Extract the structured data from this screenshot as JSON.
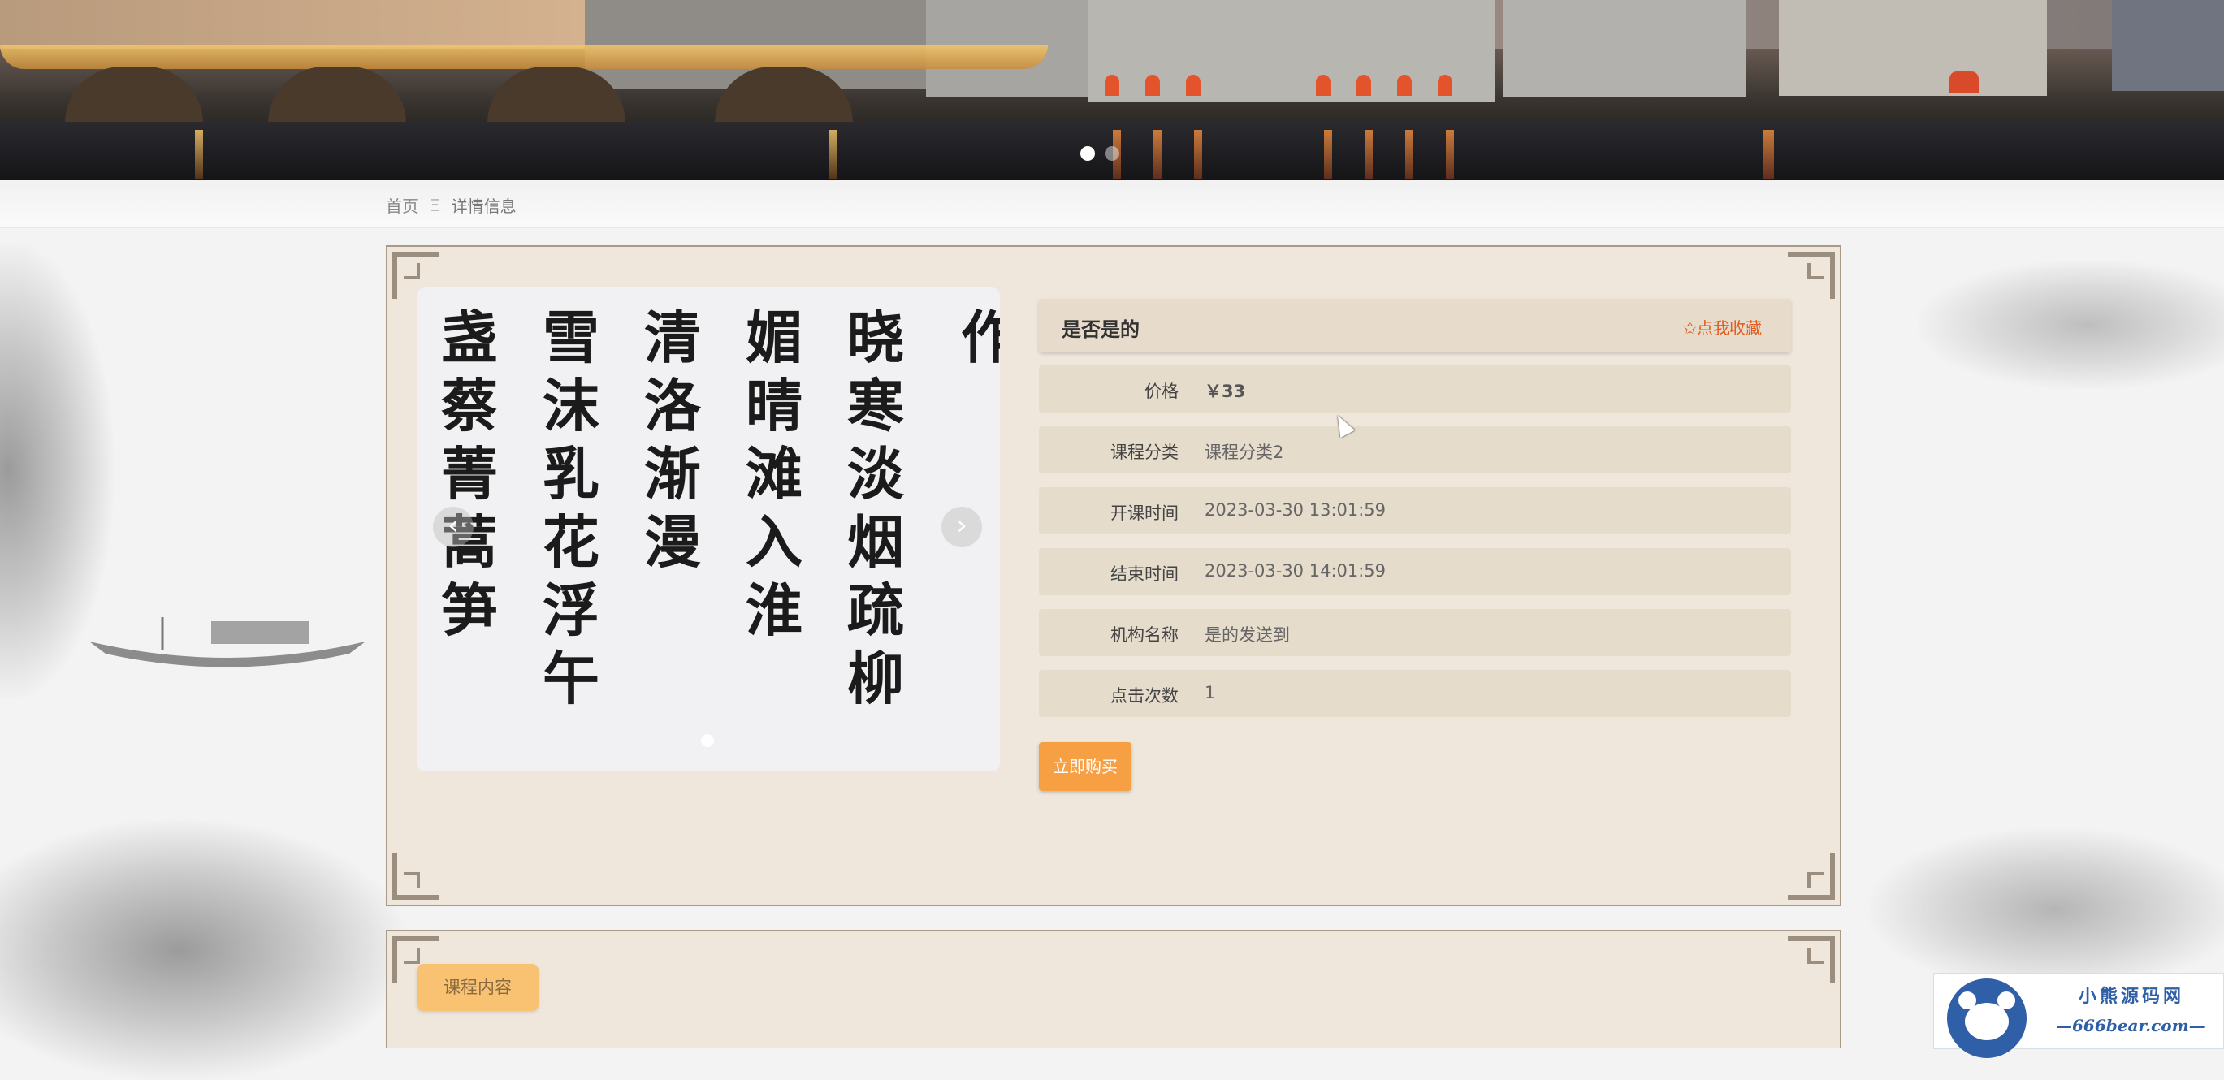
{
  "banner": {
    "slides": 2,
    "active_slide": 1
  },
  "breadcrumb": {
    "home": "首页",
    "separator": "Ξ",
    "current": "详情信息"
  },
  "gallery": {
    "prev_label": "‹",
    "next_label": "›",
    "columns": [
      "盏蔡菁蒿笋",
      "雪沫乳花浮午",
      "清洛渐漫",
      "媚晴滩入淮",
      "晓寒淡烟疏柳",
      "作"
    ]
  },
  "detail": {
    "title": "是否是的",
    "favorite_label": "✩点我收藏",
    "rows": [
      {
        "label": "价格",
        "value": "￥33"
      },
      {
        "label": "课程分类",
        "value": "课程分类2"
      },
      {
        "label": "开课时间",
        "value": "2023-03-30 13:01:59"
      },
      {
        "label": "结束时间",
        "value": "2023-03-30 14:01:59"
      },
      {
        "label": "机构名称",
        "value": "是的发送到"
      },
      {
        "label": "点击次数",
        "value": "1"
      }
    ],
    "buy_label": "立即购买"
  },
  "content": {
    "tab_label": "课程内容"
  },
  "watermark": {
    "title": "小熊源码网",
    "url": "—666bear.com—"
  },
  "colors": {
    "panel_bg": "#efe7db",
    "row_bg": "#e6dccb",
    "accent_orange": "#f6a043",
    "favorite_red": "#e05a1c",
    "logo_blue": "#2f5fa6"
  }
}
